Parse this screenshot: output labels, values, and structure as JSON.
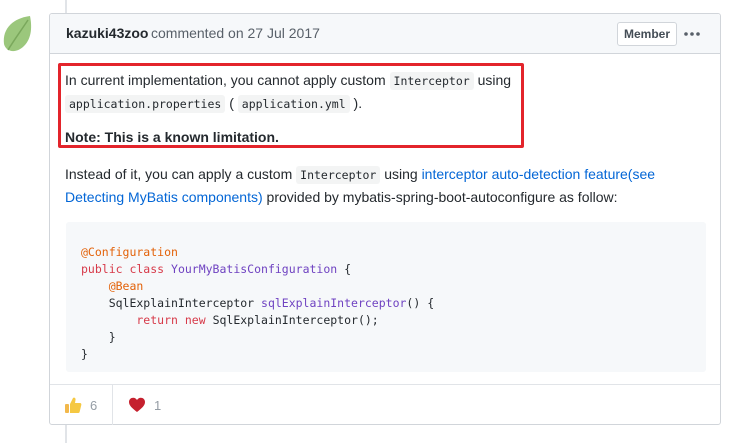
{
  "comment": {
    "author": "kazuki43zoo",
    "meta": "commented on 27 Jul 2017",
    "badge": "Member",
    "highlight_color": "#e3242b",
    "p1_a": "In current implementation, you cannot apply custom ",
    "p1_code1": "Interceptor",
    "p1_b": " using",
    "p1_code2": "application.properties",
    "p1_c": " ( ",
    "p1_code3": "application.yml",
    "p1_d": " ).",
    "note": "Note: This is a known limitation.",
    "p2_a": "Instead of it, you can apply a custom ",
    "p2_code": "Interceptor",
    "p2_b": " using ",
    "p2_link1": "interceptor auto-detection feature(see",
    "p2_link2": "Detecting MyBatis components)",
    "p2_c": " provided by mybatis-spring-boot-autoconfigure as follow:",
    "code": {
      "l1": "@Configuration",
      "l2_kw": "public class ",
      "l2_cls": "YourMyBatisConfiguration",
      "l2_rest": " {",
      "l3": "    @Bean",
      "l4_a": "    SqlExplainInterceptor ",
      "l4_fn": "sqlExplainInterceptor",
      "l4_b": "() {",
      "l5_kw": "        return new ",
      "l5_rest": "SqlExplainInterceptor();",
      "l6": "    }",
      "l7": "}"
    }
  },
  "reactions": [
    {
      "icon": "thumbs-up-icon",
      "count": "6"
    },
    {
      "icon": "heart-icon",
      "count": "1"
    }
  ]
}
